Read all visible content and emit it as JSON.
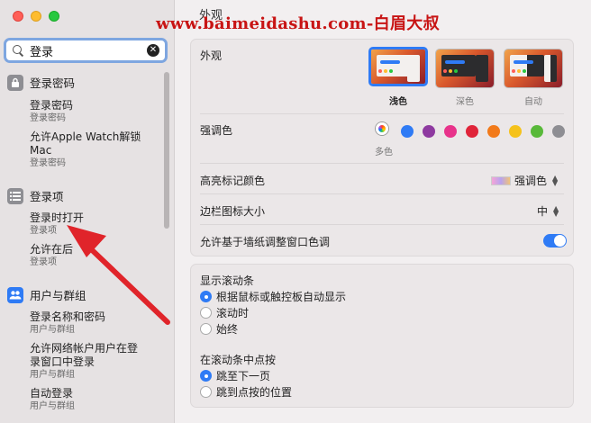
{
  "watermark": "www.baimeidashu.com-白眉大叔",
  "search": {
    "value": "登录"
  },
  "sidebar": {
    "sections": [
      {
        "label": "登录密码",
        "items": [
          {
            "title": "登录密码",
            "sub": "登录密码"
          },
          {
            "title": "允许Apple Watch解锁Mac",
            "sub": "登录密码"
          }
        ]
      },
      {
        "label": "登录项",
        "items": [
          {
            "title": "登录时打开",
            "sub": "登录项"
          },
          {
            "title": "允许在后",
            "sub": "登录项"
          }
        ]
      },
      {
        "label": "用户与群组",
        "items": [
          {
            "title": "登录名称和密码",
            "sub": "用户与群组"
          },
          {
            "title": "允许网络帐户用户在登录窗口中登录",
            "sub": "用户与群组"
          },
          {
            "title": "自动登录",
            "sub": "用户与群组"
          }
        ]
      }
    ]
  },
  "main": {
    "title": "外观",
    "appearance": {
      "label": "外观",
      "options": [
        "浅色",
        "深色",
        "自动"
      ],
      "selected": "浅色"
    },
    "accent": {
      "label": "强调色",
      "selected_label": "多色",
      "colors": [
        "#2f7bf5",
        "#8e3aa0",
        "#e8338b",
        "#e0243a",
        "#f27a1a",
        "#f5c21b",
        "#59b93a",
        "#8e8e93"
      ]
    },
    "highlight": {
      "label": "高亮标记颜色",
      "value": "强调色"
    },
    "sidebar_icon": {
      "label": "边栏图标大小",
      "value": "中"
    },
    "wallpaper_tint": {
      "label": "允许基于墙纸调整窗口色调",
      "on": true
    },
    "scrollbars": {
      "label": "显示滚动条",
      "options": [
        "根据鼠标或触控板自动显示",
        "滚动时",
        "始终"
      ],
      "selected": 0
    },
    "click_scroll": {
      "label": "在滚动条中点按",
      "options": [
        "跳至下一页",
        "跳到点按的位置"
      ],
      "selected": 0
    }
  },
  "colors": {
    "accent": "#2f7bf5",
    "arrow": "#e0242a"
  }
}
